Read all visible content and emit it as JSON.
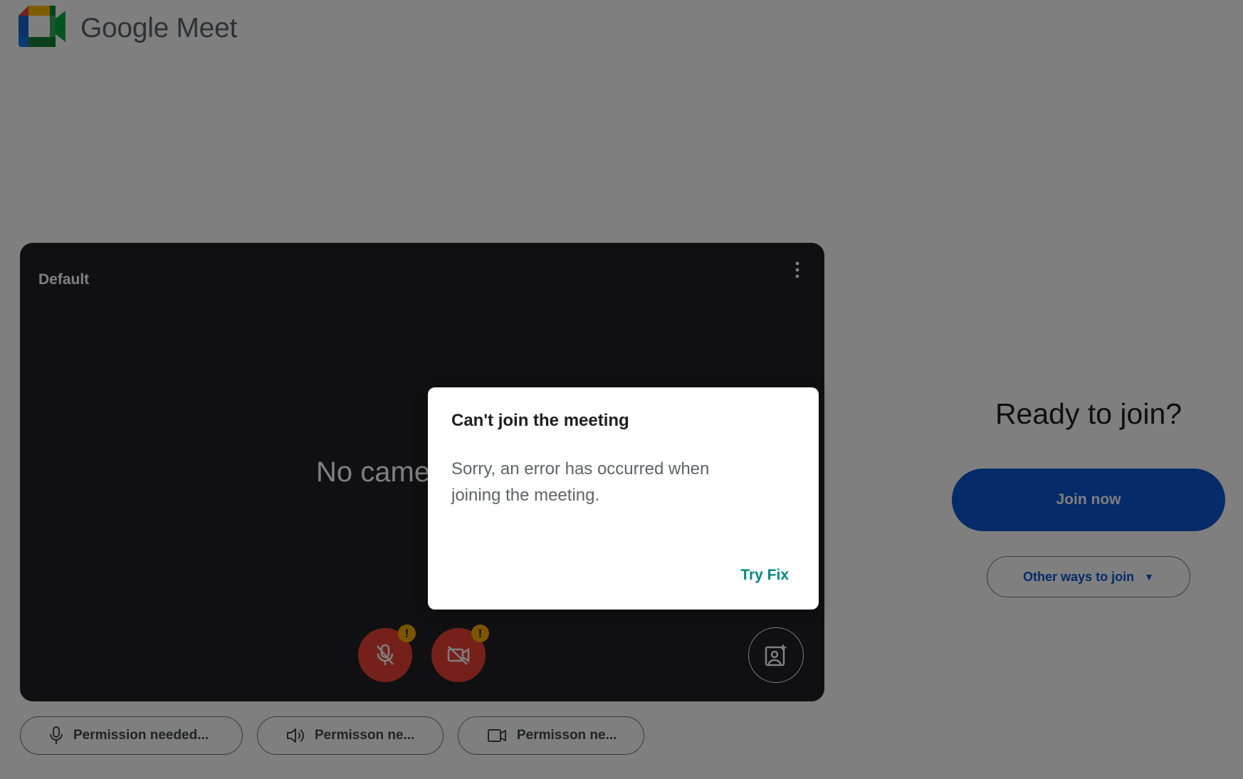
{
  "header": {
    "brand": "Google Meet",
    "logo_icon": "google-meet-logo"
  },
  "preview": {
    "device_name": "Default",
    "no_camera_text": "No came",
    "controls": {
      "mic_state": "muted",
      "camera_state": "off",
      "warning_badge": "!"
    }
  },
  "permissions": [
    {
      "icon": "microphone-icon",
      "label": "Permission needed..."
    },
    {
      "icon": "speaker-icon",
      "label": "Permisson ne..."
    },
    {
      "icon": "camera-icon",
      "label": "Permisson ne..."
    }
  ],
  "join_panel": {
    "heading": "Ready to join?",
    "join_label": "Join now",
    "other_label": "Other ways to join",
    "other_caret": "▼"
  },
  "dialog": {
    "title": "Can't join the meeting",
    "body": "Sorry, an error has occurred when joining the meeting.",
    "action_label": "Try Fix"
  },
  "colors": {
    "primary": "#0b57d0",
    "danger": "#ea4335",
    "warning": "#f9ab00",
    "action": "#00897b",
    "preview_bg": "#202124"
  }
}
